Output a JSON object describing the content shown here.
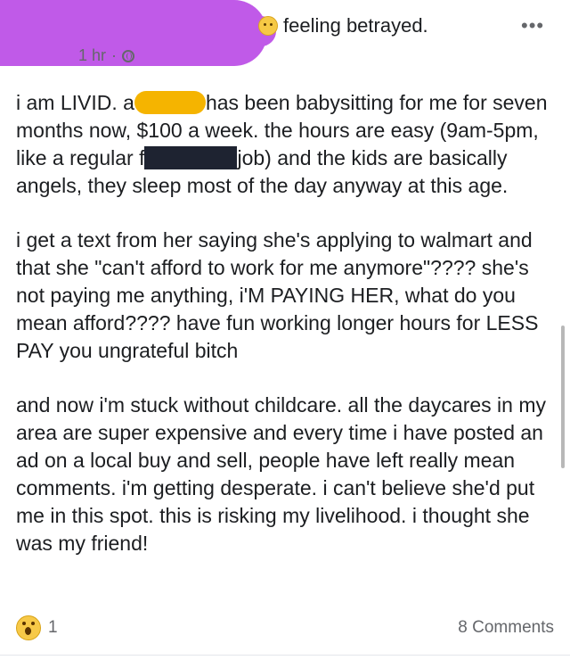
{
  "header": {
    "feeling": "feeling betrayed.",
    "feeling_icon": "sad-face-icon",
    "more_label": "•••",
    "time": "1 hr",
    "separator": "·",
    "privacy_icon": "globe-icon"
  },
  "post": {
    "p1": {
      "a": "i am LIVID. a",
      "b": "has been babysitting for me for seven months now, $100 a week. the hours are easy (9am-5pm, like a regular f",
      "c": "job) and the kids are basically angels, they sleep most of the day anyway at this age."
    },
    "p2": "i get a text from her saying she's applying to walmart and that she \"can't afford to work for me anymore\"???? she's not paying me anything, i'M PAYING HER, what do you mean afford???? have fun working longer hours for LESS PAY you ungrateful bitch",
    "p3": "and now i'm stuck without childcare. all the daycares in my area are super expensive and every time i have posted an ad on a local buy and sell, people have left really mean comments. i'm getting desperate. i can't believe she'd put me in this spot. this is risking my livelihood. i thought she was my friend!"
  },
  "footer": {
    "reaction_icon": "wow-emoji-icon",
    "reaction_count": "1",
    "comments": "8 Comments"
  },
  "colors": {
    "redaction_purple": "#c05ae8",
    "redaction_yellow": "#f5b400",
    "redaction_black": "#1e2331",
    "meta_gray": "#65676b"
  }
}
